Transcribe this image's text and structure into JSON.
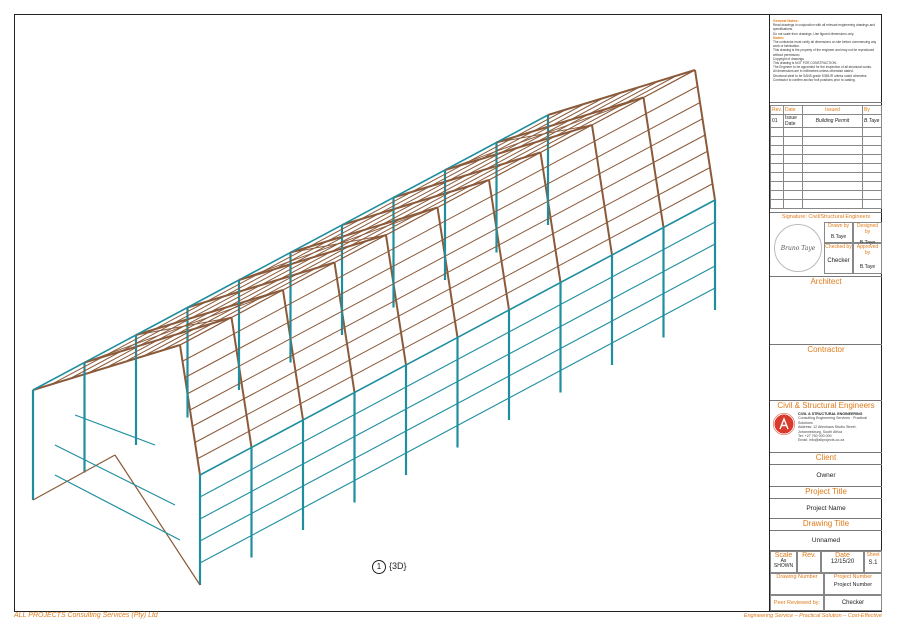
{
  "notes": {
    "title": "General Notes:",
    "lines": [
      "Read drawings in conjunction with all relevant engineering drawings and specifications.",
      "Do not scale from drawings. Use figured dimensions only.",
      "Notes:",
      "The contractor must verify all dimensions on site before commencing any work or fabrication.",
      "This drawing is the property of the engineer and may not be reproduced without permission.",
      "Copyright of drawings.",
      "This drawing is NOT FOR CONSTRUCTION.",
      "The Engineer to be appointed for the inspection of all structural works.",
      "All dimensions are in millimetres unless otherwise stated.",
      "Structural steel to be SANS grade S355JR unless noted otherwise.",
      "Contractor to confirm anchor bolt positions prior to casting."
    ]
  },
  "revisions": {
    "headers": [
      "Rev.",
      "Date",
      "Issued",
      "By"
    ],
    "rows": [
      [
        "01",
        "Issue Date",
        "Building Permit",
        "B.Taye"
      ]
    ]
  },
  "signature": {
    "title": "Signature: Civil/Structural Engineers",
    "drawn_by_label": "Drawn by",
    "drawn_by": "B.Taye",
    "designed_by_label": "Designed by",
    "designed_by": "B.Taye",
    "checked_by_label": "Checked by",
    "checked_by": "Checker",
    "approved_by_label": "Approved by",
    "approved_by": "B.Taye",
    "stamp_text": "Bruno Taye"
  },
  "architect_label": "Architect",
  "contractor_label": "Contractor",
  "engineers": {
    "title": "Civil & Structural Engineers",
    "company": "ALL PROJECTS",
    "subtitle": "CIVIL & STRUCTURAL ENGINEERING",
    "tagline": "Consulting Engineering Services · Practical Solutions",
    "address1": "Address: 12 Allenhaus Studio Street,",
    "address2": "Johannesburg, South Africa",
    "phone": "Tel: +27 760 000 000",
    "email": "Email: info@allprojects.co.za"
  },
  "client": {
    "label": "Client",
    "value": "Owner"
  },
  "project_title": {
    "label": "Project Title",
    "value": "Project Name"
  },
  "drawing_title": {
    "label": "Drawing Title",
    "value": "Unnamed"
  },
  "scale": {
    "label": "Scale",
    "value": "As SHOWN"
  },
  "rev": {
    "label": "Rev.",
    "value": ""
  },
  "date": {
    "label": "Date",
    "value": "12/15/20"
  },
  "sheet": {
    "label": "Sheet",
    "value": "S.1"
  },
  "drawing_number": {
    "label": "Drawing Number",
    "value": ""
  },
  "project_number": {
    "label": "Project Number",
    "value": "Project Number"
  },
  "peer_review": {
    "label": "Peer Reviewed by:",
    "value": "Checker"
  },
  "view": {
    "number": "1",
    "name": "{3D}"
  },
  "footer": {
    "left": "ALL PROJECTS Consulting Services (Pty) Ltd",
    "right": "Engineering Service – Practical Solution – Cost-Effective"
  },
  "colors": {
    "accent": "#e07b1a",
    "steel_cyan": "#1f8fa0",
    "steel_brown": "#8a5a3a"
  }
}
